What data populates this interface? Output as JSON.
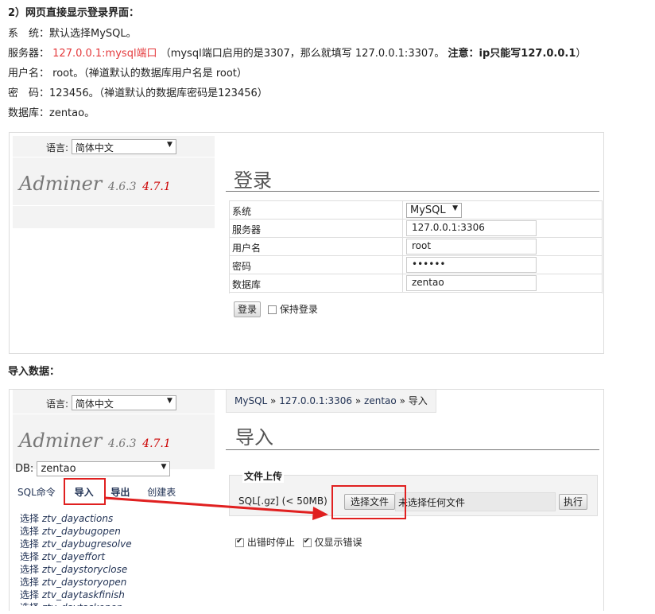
{
  "doc": {
    "heading": "2）网页直接显示登录界面：",
    "line_system": "系　统：默认选择MySQL。",
    "server_label": "服务器：",
    "server_value": "127.0.0.1:mysql端口",
    "server_note": "（mysql端口启用的是3307，那么就填写 127.0.0.1:3307。",
    "server_warn": "注意：ip只能写127.0.0.1",
    "server_close": "）",
    "line_user": "用户名： root。（禅道默认的数据库用户名是 root）",
    "line_pass": "密　码：123456。（禅道默认的数据库密码是123456）",
    "line_db": "数据库：zentao。",
    "import_heading": "导入数据："
  },
  "login": {
    "lang_label": "语言:",
    "lang_value": "简体中文",
    "logo_name": "Adminer",
    "logo_version": "4.6.3",
    "logo_new": "4.7.1",
    "title": "登录",
    "fields": [
      {
        "label": "系统",
        "value": "MySQL"
      },
      {
        "label": "服务器",
        "value": "127.0.0.1:3306"
      },
      {
        "label": "用户名",
        "value": "root"
      },
      {
        "label": "密码",
        "value": "••••••"
      },
      {
        "label": "数据库",
        "value": "zentao"
      }
    ],
    "submit": "登录",
    "remember": "保持登录"
  },
  "import": {
    "lang_label": "语言:",
    "lang_value": "简体中文",
    "logo_name": "Adminer",
    "logo_version": "4.6.3",
    "logo_new": "4.7.1",
    "db_label": "DB:",
    "db_value": "zentao",
    "menu": [
      "SQL命令",
      "导入",
      "导出",
      "创建表"
    ],
    "tables_prefix": "选择",
    "tables": [
      "ztv_dayactions",
      "ztv_daybugopen",
      "ztv_daybugresolve",
      "ztv_dayeffort",
      "ztv_daystoryclose",
      "ztv_daystoryopen",
      "ztv_daytaskfinish",
      "ztv_daytaskopen"
    ],
    "breadcrumb": [
      "MySQL",
      "127.0.0.1:3306",
      "zentao",
      "导入"
    ],
    "breadcrumb_sep": "»",
    "title": "导入",
    "fieldset_title": "文件上传",
    "file_label": "SQL[.gz] (< 50MB)",
    "choose_file": "选择文件",
    "no_file": "未选择任何文件",
    "execute": "执行",
    "stop_on_error": "出错时停止",
    "only_errors": "仅显示错误"
  },
  "colors": {
    "accent_red": "#e02020",
    "link": "#223355"
  }
}
